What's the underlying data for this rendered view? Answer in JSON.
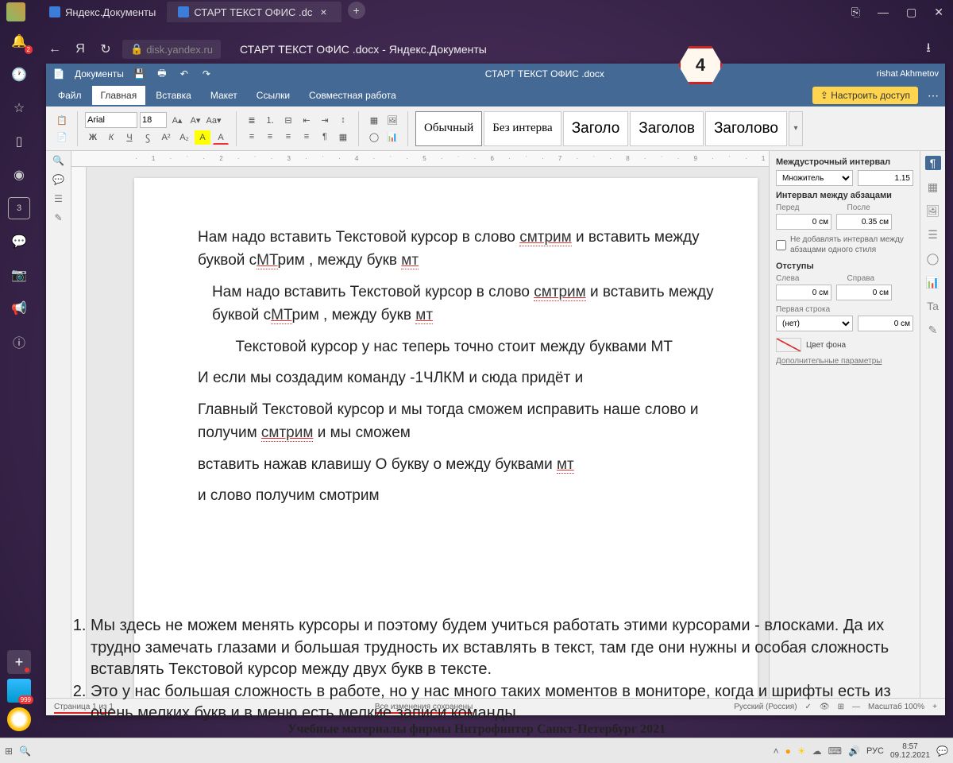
{
  "os": {
    "tab1": "Яндекс.Документы",
    "tab2": "СТАРТ ТЕКСТ ОФИС .dc",
    "taskbar": {
      "lang": "РУС",
      "time": "8:57",
      "date": "09.12.2021"
    },
    "badges": {
      "bell": "2",
      "app": "999"
    }
  },
  "browser": {
    "url_host": "disk.yandex.ru",
    "title": "СТАРТ ТЕКСТ ОФИС .docx - Яндекс.Документы"
  },
  "hexagon": "4",
  "editor": {
    "titlebar": {
      "brand": "Документы",
      "docname": "СТАРТ ТЕКСТ ОФИС .docx",
      "user": "rishat Akhmetov"
    },
    "tabs": {
      "file": "Файл",
      "home": "Главная",
      "insert": "Вставка",
      "layout": "Макет",
      "links": "Ссылки",
      "collab": "Совместная работа"
    },
    "access_btn": "Настроить доступ",
    "toolbar": {
      "font": "Arial",
      "size": "18",
      "bold": "Ж",
      "italic": "К",
      "under": "Ч",
      "strike": "Ꚃ",
      "sup": "A²",
      "sub": "A₂"
    },
    "styles": {
      "normal": "Обычный",
      "nospace": "Без интерва",
      "h1": "Заголо",
      "h2": "Заголов",
      "h3": "Заголово"
    },
    "status": {
      "page": "Страница 1 из 1",
      "saved": "Все изменения сохранены",
      "lang": "Русский (Россия)",
      "zoom": "Масштаб 100%"
    }
  },
  "panel": {
    "line_spacing_title": "Междустрочный интервал",
    "multiplier": "Множитель",
    "mult_val": "1.15",
    "para_spacing_title": "Интервал между абзацами",
    "before_lbl": "Перед",
    "after_lbl": "После",
    "before_val": "0 см",
    "after_val": "0.35 см",
    "no_add_space": "Не добавлять интервал между абзацами одного стиля",
    "indents_title": "Отступы",
    "left_lbl": "Слева",
    "right_lbl": "Справа",
    "left_val": "0 см",
    "right_val": "0 см",
    "first_line": "Первая строка",
    "first_sel": "(нет)",
    "first_val": "0 см",
    "bg_color": "Цвет фона",
    "more": "Дополнительные параметры"
  },
  "doc": {
    "p1a": "Нам надо вставить Текстовой курсор в слово ",
    "p1u": "смтрим",
    "p1b": " и вставить между буквой с",
    "p1u2": "МТ",
    "p1c": "рим , между букв ",
    "p1u3": "мт",
    "p2a": "Нам надо вставить Текстовой курсор в слово ",
    "p2u": "смтрим",
    "p2b": " и вставить между буквой с",
    "p2u2": "МТ",
    "p2c": "рим , между букв ",
    "p2u3": "мт",
    "p3": "         Текстовой курсор у нас теперь точно стоит между буквами МТ",
    "p4": "И если мы создадим команду -1ЧЛКМ и сюда придёт и",
    "p5a": "Главный Текстовой курсор и мы тогда сможем исправить наше слово и получим ",
    "p5u": "смтрим",
    "p5b": " и мы сможем",
    "p6a": "вставить нажав клавишу О букву о между буквами ",
    "p6u": "мт",
    "p7": "и слово получим смотрим"
  },
  "overlay": {
    "li1": "Мы здесь не можем менять курсоры и поэтому будем учиться работать этими курсорами - влосками. Да их трудно замечать глазами и большая трудность их вставлять в текст, там где они нужны и особая сложность вставлять Текстовой курсор между двух букв в тексте.",
    "li2": "Это у нас большая сложность в работе, но у нас много таких моментов в мониторе, когда и шрифты есть из очень мелких букв и в меню есть мелкие записи команды."
  },
  "footer": "Учебные материалы фирмы Нитрофинтер Санкт-Петербург 2021"
}
